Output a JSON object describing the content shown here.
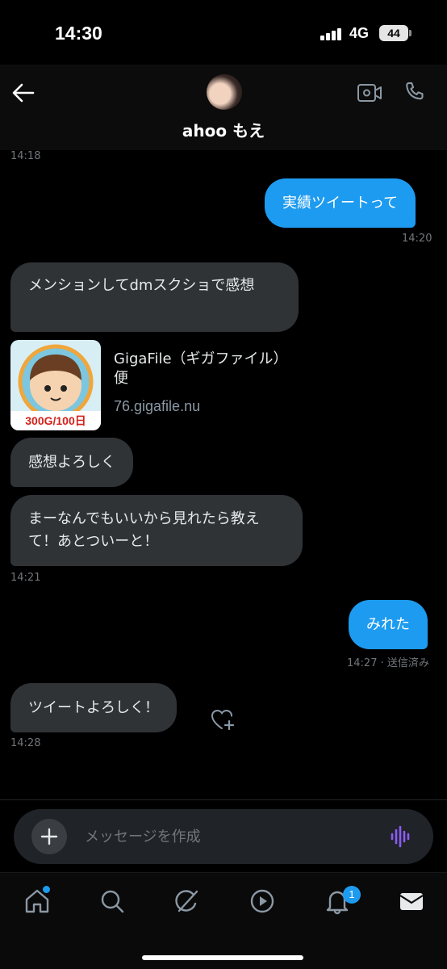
{
  "status_bar": {
    "time": "14:30",
    "network": "4G",
    "battery": "44"
  },
  "header": {
    "contact_name": "ahoo もえ"
  },
  "messages": {
    "ts_0": "14:18",
    "m1": "実績ツイートって",
    "ts_1": "14:20",
    "m2": "メンションしてdmスクショで感想",
    "link": {
      "title": "GigaFile（ギガファイル）便",
      "domain": "76.gigafile.nu",
      "thumb_banner": "300G/100日"
    },
    "m3": "感想よろしく",
    "m4": "まーなんでもいいから見れたら教えて！あとついーと！",
    "ts_2": "14:21",
    "m5": "みれた",
    "ts_3": "14:27 · 送信済み",
    "m6": "ツイートよろしく！",
    "ts_4": "14:28"
  },
  "composer": {
    "placeholder": "メッセージを作成"
  },
  "tabbar": {
    "notifications_count": "1"
  },
  "colors": {
    "accent": "#1d9bf0",
    "incoming_bubble": "#2f3336",
    "voice_icon": "#8b5cf6"
  },
  "icons": [
    "back-arrow-icon",
    "video-call-icon",
    "phone-icon",
    "heart-add-icon",
    "plus-icon",
    "voice-wave-icon",
    "home-icon",
    "search-icon",
    "grok-icon",
    "play-icon",
    "bell-icon",
    "mail-icon"
  ]
}
